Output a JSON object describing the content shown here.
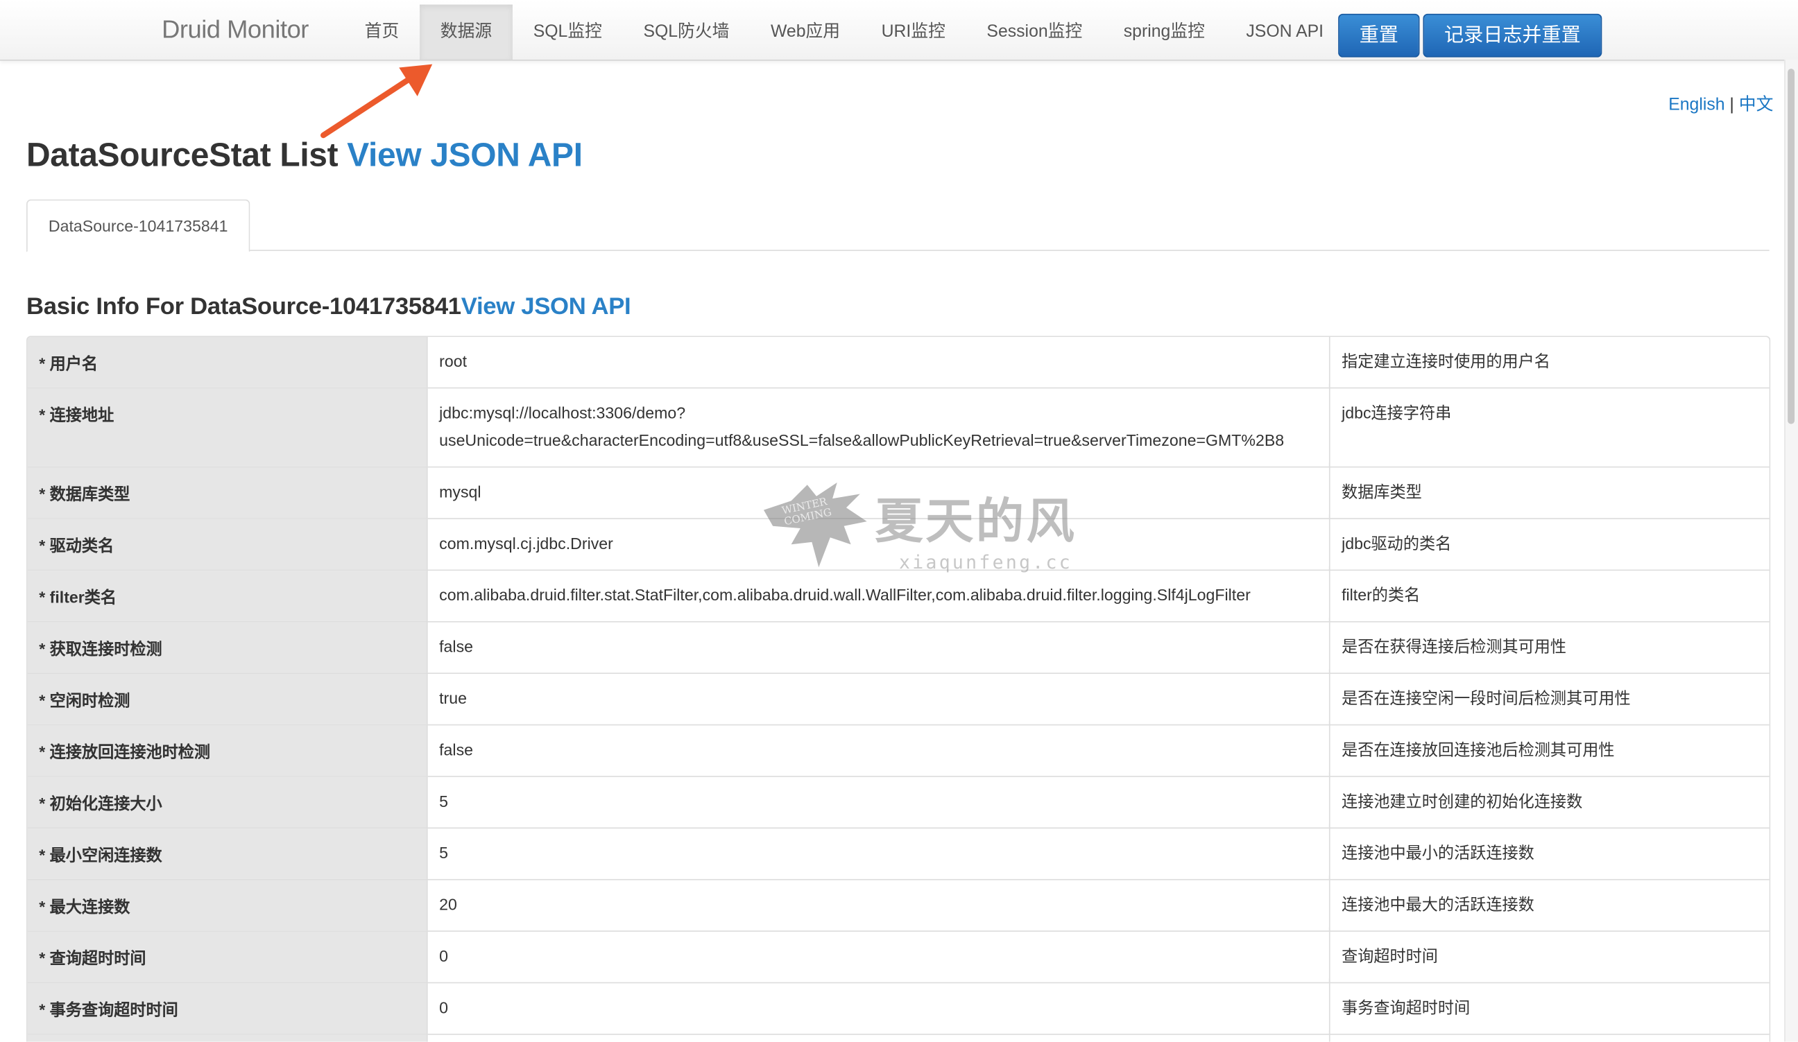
{
  "navbar": {
    "brand": "Druid Monitor",
    "items": [
      {
        "label": "首页",
        "active": false
      },
      {
        "label": "数据源",
        "active": true
      },
      {
        "label": "SQL监控",
        "active": false
      },
      {
        "label": "SQL防火墙",
        "active": false
      },
      {
        "label": "Web应用",
        "active": false
      },
      {
        "label": "URI监控",
        "active": false
      },
      {
        "label": "Session监控",
        "active": false
      },
      {
        "label": "spring监控",
        "active": false
      },
      {
        "label": "JSON API",
        "active": false
      }
    ],
    "reset_label": "重置",
    "log_reset_label": "记录日志并重置"
  },
  "lang": {
    "english": "English",
    "separator": "|",
    "chinese": "中文"
  },
  "page": {
    "title": "DataSourceStat List",
    "title_link": "View JSON API",
    "tab_label": "DataSource-1041735841",
    "basic_info_title": "Basic Info For DataSource-1041735841",
    "basic_info_link": "View JSON API"
  },
  "basic_info": [
    {
      "name": "* 用户名",
      "value": [
        "root"
      ],
      "desc": "指定建立连接时使用的用户名"
    },
    {
      "name": "* 连接地址",
      "value": [
        "jdbc:mysql://localhost:3306/demo?",
        "useUnicode=true&characterEncoding=utf8&useSSL=false&allowPublicKeyRetrieval=true&serverTimezone=GMT%2B8"
      ],
      "desc": "jdbc连接字符串"
    },
    {
      "name": "* 数据库类型",
      "value": [
        "mysql"
      ],
      "desc": "数据库类型"
    },
    {
      "name": "* 驱动类名",
      "value": [
        "com.mysql.cj.jdbc.Driver"
      ],
      "desc": "jdbc驱动的类名"
    },
    {
      "name": "* filter类名",
      "value": [
        "com.alibaba.druid.filter.stat.StatFilter,com.alibaba.druid.wall.WallFilter,com.alibaba.druid.filter.logging.Slf4jLogFilter"
      ],
      "desc": "filter的类名"
    },
    {
      "name": "* 获取连接时检测",
      "value": [
        "false"
      ],
      "desc": "是否在获得连接后检测其可用性"
    },
    {
      "name": "* 空闲时检测",
      "value": [
        "true"
      ],
      "desc": "是否在连接空闲一段时间后检测其可用性"
    },
    {
      "name": "* 连接放回连接池时检测",
      "value": [
        "false"
      ],
      "desc": "是否在连接放回连接池后检测其可用性"
    },
    {
      "name": "* 初始化连接大小",
      "value": [
        "5"
      ],
      "desc": "连接池建立时创建的初始化连接数"
    },
    {
      "name": "* 最小空闲连接数",
      "value": [
        "5"
      ],
      "desc": "连接池中最小的活跃连接数"
    },
    {
      "name": "* 最大连接数",
      "value": [
        "20"
      ],
      "desc": "连接池中最大的活跃连接数"
    },
    {
      "name": "* 查询超时时间",
      "value": [
        "0"
      ],
      "desc": "查询超时时间"
    },
    {
      "name": "* 事务查询超时时间",
      "value": [
        "0"
      ],
      "desc": "事务查询超时时间"
    },
    {
      "name": "",
      "value": [
        ""
      ],
      "desc": ""
    }
  ],
  "watermark": {
    "title": "夏天的风",
    "subtitle": "xiaqunfeng.cc",
    "logo_text_1": "WINTER",
    "logo_text_2": "COMING"
  },
  "colors": {
    "link": "#2a81c7",
    "button": "#1f66b5",
    "arrow": "#ec5a2c",
    "label_bg": "#e6e6e6"
  },
  "icons": {
    "annotation": "arrow-annotation-icon",
    "watermark_logo": "wolf-logo-icon"
  }
}
